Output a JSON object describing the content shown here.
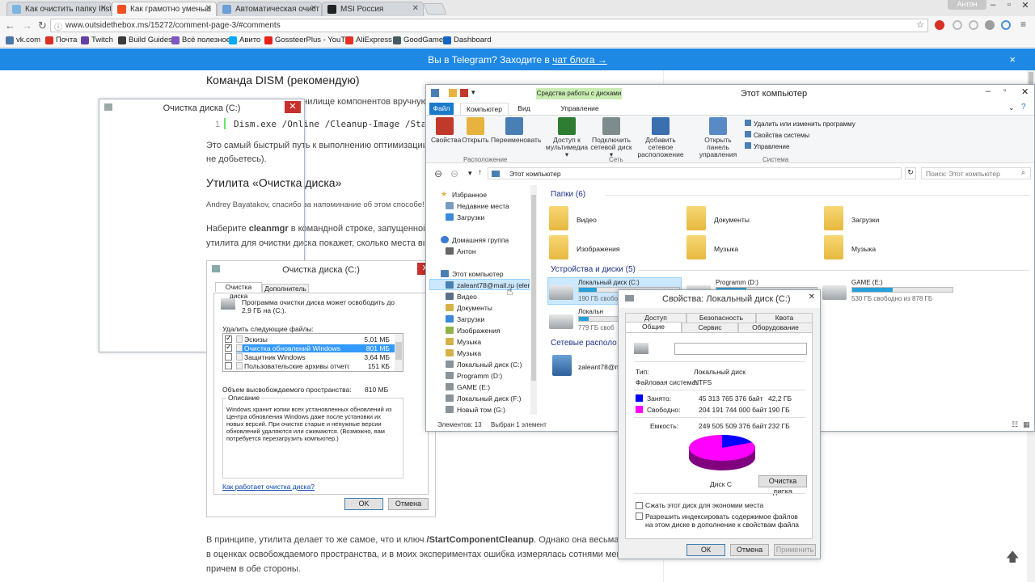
{
  "browser": {
    "tabs": [
      {
        "title": "Как очистить папку Inst",
        "color": "#7cb5e0"
      },
      {
        "title": "Как грамотно уменьш",
        "color": "#f25022"
      },
      {
        "title": "Автоматическая очист",
        "color": "#6a9fd8"
      },
      {
        "title": "MSI Россия",
        "color": "#222222"
      }
    ],
    "user": "Антон",
    "url": "www.outsidethebox.ms/15272/comment-page-3/#comments",
    "bookmarks": [
      {
        "label": "vk.com",
        "color": "#4a76a8"
      },
      {
        "label": "Почта",
        "color": "#d93025"
      },
      {
        "label": "Twitch",
        "color": "#6441a5"
      },
      {
        "label": "Build Guides",
        "color": "#3a3a3a"
      },
      {
        "label": "Всё полезное",
        "color": "#7e57c2"
      },
      {
        "label": "Авито",
        "color": "#00aaff"
      },
      {
        "label": "GossteerPlus - YouTu",
        "color": "#e62117"
      },
      {
        "label": "AliExpress",
        "color": "#e43225"
      },
      {
        "label": "GoodGame",
        "color": "#455a64"
      },
      {
        "label": "Dashboard",
        "color": "#1565c0"
      }
    ],
    "banner": {
      "text": "Вы в Telegram? Заходите в ",
      "link": "чат блога →",
      "close": "×"
    }
  },
  "article": {
    "heading1": "Команда DISM (рекомендую)",
    "p1_tail": "ранилище компонентов вручную одн",
    "code_line_no": "1",
    "code": "Dism.exe /Online /Cleanup-Image /StartCo",
    "p2a": "Это самый быстрый путь к выполнению оптимизации (по",
    "p2b": "не добьетесь).",
    "heading2": "Утилита «Очистка диска»",
    "credit": "Andrey Bayatakov, спасибо за напоминание об этом способе!",
    "p3a_pre": "Наберите ",
    "p3a_bold": "cleanmgr",
    "p3a_post": " в командной строке, запущенной от",
    "p3b": "утилита для очистки диска покажет, сколько места вы с",
    "p4a_pre": "В принципе, утилита делает то же самое, что и ключ ",
    "p4a_bold": "/StartComponentCleanup",
    "p4a_post": ". Однако она весьма фри",
    "p4b": "в оценках освобождаемого пространства, и в моих экспериментах ошибка измерялась сотнями мегабайт",
    "p4c": "причем в обе стороны."
  },
  "cleanup_small": {
    "title": "Очистка диска  (C:)",
    "close": "✕"
  },
  "cleanup": {
    "title": "Очистка диска  (C:)",
    "tabs": [
      "Очистка диска",
      "Дополнитель"
    ],
    "intro": "Программа очистки диска может освободить до 2,9 ГБ на (C:).",
    "delete_label": "Удалить следующие файлы:",
    "items": [
      {
        "name": "Эскизы",
        "size": "5,01 МБ",
        "checked": true,
        "selected": false
      },
      {
        "name": "Очистка обновлений Windows",
        "size": "801 МБ",
        "checked": true,
        "selected": true
      },
      {
        "name": "Защитник Windows",
        "size": "3,64 МБ",
        "checked": false,
        "selected": false
      },
      {
        "name": "Пользовательские архивы отчетов ...",
        "size": "151 КБ",
        "checked": false,
        "selected": false
      }
    ],
    "total_label": "Объем высвобождаемого пространства:",
    "total_value": "810 МБ",
    "desc_label": "Описание",
    "desc": "Windows хранит копии всех установленных обновлений из Центра обновления Windows даже после установки их новых версий. При очистке старые и ненужные версии обновлений удаляются или сжимаются. (Возможно, вам потребуется перезагрузить компьютер.)",
    "link": "Как работает очистка диска?",
    "ok": "OK",
    "cancel": "Отмена"
  },
  "explorer": {
    "title": "Этот компьютер",
    "context_tab": "Средства работы с дисками",
    "ribbon_tabs": [
      "Файл",
      "Компьютер",
      "Вид",
      "Управление"
    ],
    "ribbon": [
      {
        "label": "Свойства",
        "color": "#c0392b"
      },
      {
        "label": "Открыть",
        "color": "#e6b33e"
      },
      {
        "label": "Переименовать",
        "color": "#4a7fb5"
      },
      {
        "label": "Доступ к мультимедиа ▾",
        "color": "#2e7d32"
      },
      {
        "label": "Подключить сетевой диск ▾",
        "color": "#7f8c8d"
      },
      {
        "label": "Добавить сетевое расположение",
        "color": "#3a6fb0"
      },
      {
        "label": "Открыть панель управления",
        "color": "#5a8ac6"
      }
    ],
    "ribbon_right": [
      "Удалить или изменить программу",
      "Свойства системы",
      "Управление"
    ],
    "groups": [
      "Расположение",
      "Сеть",
      "Система"
    ],
    "address": "Этот компьютер",
    "search_placeholder": "Поиск: Этот компьютер",
    "nav": [
      "Избранное",
      "Недавние места",
      "Загрузки",
      "Домашняя группа",
      "Антон",
      "Этот компьютер",
      "zaleant78@mail.ru (elena",
      "Видео",
      "Документы",
      "Загрузки",
      "Изображения",
      "Музыка",
      "Музыка",
      "Локальный диск (C:)",
      "Programm (D:)",
      "GAME (E:)",
      "Локальный диск (F:)",
      "Новый том (G:)"
    ],
    "folders_header": "Папки (6)",
    "folders": [
      "Видео",
      "Документы",
      "Загрузки",
      "Изображения",
      "Музыка",
      "Музыка"
    ],
    "drives_header": "Устройства и диски (5)",
    "drives": [
      {
        "name": "Локальный диск (C:)",
        "free": "190 ГБ свободно",
        "fill": 0.18
      },
      {
        "name": "Programm (D:)",
        "free": "",
        "fill": 0.3
      },
      {
        "name": "GAME (E:)",
        "free": "530 ГБ свободно из 878 ГБ",
        "fill": 0.4
      },
      {
        "name": "Локальн",
        "free": "779 ГБ своб",
        "fill": 0.2
      }
    ],
    "network_header": "Сетевые располо",
    "network": "zaleant78@ma",
    "status": "Элементов: 13",
    "selected": "Выбран 1 элемент"
  },
  "props": {
    "title": "Свойства: Локальный диск (C:)",
    "tabs_top": [
      "Доступ",
      "Безопасность",
      "Квота"
    ],
    "tabs_bottom": [
      "Общие",
      "Сервис",
      "Оборудование"
    ],
    "type_label": "Тип:",
    "type_value": "Локальный диск",
    "fs_label": "Файловая система:",
    "fs_value": "NTFS",
    "used_label": "Занято:",
    "used_bytes": "45 313 765 376 байт",
    "used_gb": "42,2 ГБ",
    "free_label": "Свободно:",
    "free_bytes": "204 191 744 000 байт",
    "free_gb": "190 ГБ",
    "cap_label": "Емкость:",
    "cap_bytes": "249 505 509 376 байт",
    "cap_gb": "232 ГБ",
    "used_color": "#0000ff",
    "free_color": "#ff00ff",
    "disk_label": "Диск C",
    "cleanup_btn": "Очистка диска",
    "compress": "Сжать этот диск для экономии места",
    "index": "Разрешить индексировать содержимое файлов на этом диске в дополнение к свойствам файла",
    "ok": "ОК",
    "cancel": "Отмена",
    "apply": "Применить",
    "used_fraction": 0.18
  }
}
